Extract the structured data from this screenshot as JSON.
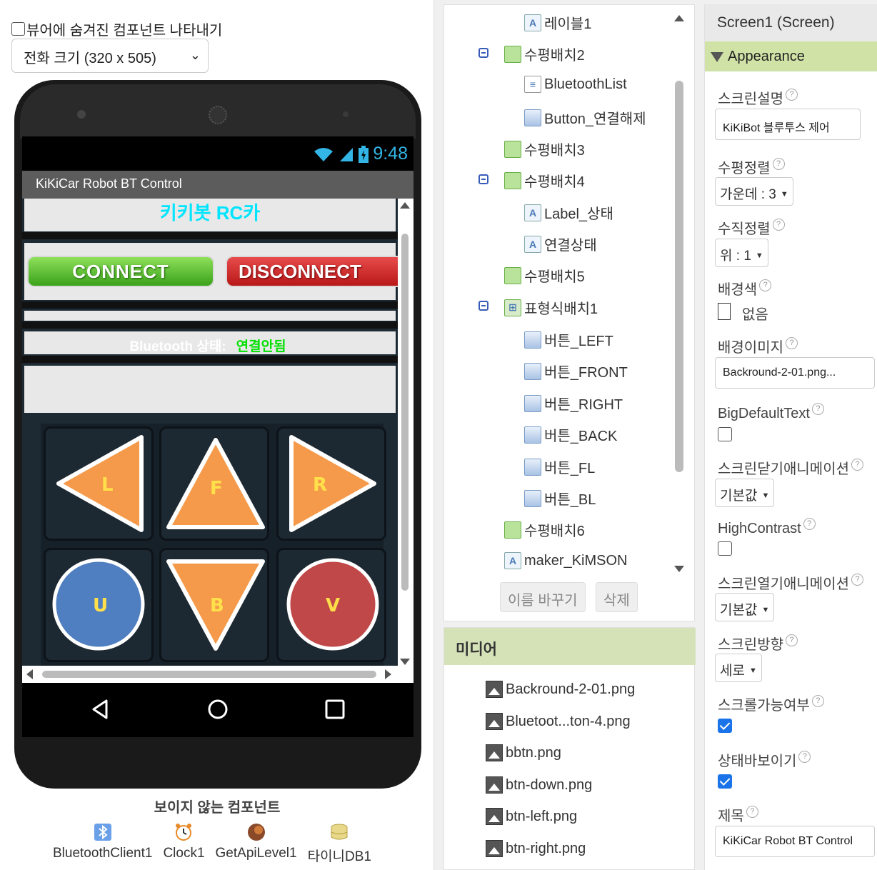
{
  "viewer": {
    "show_hidden_label": "뷰어에 숨겨진 컴포넌트 나타내기",
    "size_select": "전화 크기 (320 x 505)"
  },
  "phone": {
    "status_time": "9:48",
    "title_bar": "KiKiCar Robot BT Control",
    "app_title": "키키봇 RC카",
    "connect_label": "CONNECT",
    "disconnect_label": "DISCONNECT",
    "bt_status_label": "Bluetooth 상태:",
    "bt_status_value": "연결안됨",
    "controls": [
      "L",
      "F",
      "R",
      "U",
      "B",
      "V"
    ]
  },
  "nonvisible": {
    "title": "보이지 않는 컴포넌트",
    "items": [
      "BluetoothClient1",
      "Clock1",
      "GetApiLevel1",
      "타이니DB1"
    ]
  },
  "tree": {
    "items": [
      {
        "label": "레이블1",
        "icon": "label-icon"
      },
      {
        "label": "수평배치2",
        "icon": "horizontal-arrangement-icon"
      },
      {
        "label": "BluetoothList",
        "icon": "list-picker-icon"
      },
      {
        "label": "Button_연결해제",
        "icon": "button-icon"
      },
      {
        "label": "수평배치3",
        "icon": "horizontal-arrangement-icon"
      },
      {
        "label": "수평배치4",
        "icon": "horizontal-arrangement-icon"
      },
      {
        "label": "Label_상태",
        "icon": "label-icon"
      },
      {
        "label": "연결상태",
        "icon": "label-icon"
      },
      {
        "label": "수평배치5",
        "icon": "horizontal-arrangement-icon"
      },
      {
        "label": "표형식배치1",
        "icon": "table-arrangement-icon"
      },
      {
        "label": "버튼_LEFT",
        "icon": "button-icon"
      },
      {
        "label": "버튼_FRONT",
        "icon": "button-icon"
      },
      {
        "label": "버튼_RIGHT",
        "icon": "button-icon"
      },
      {
        "label": "버튼_BACK",
        "icon": "button-icon"
      },
      {
        "label": "버튼_FL",
        "icon": "button-icon"
      },
      {
        "label": "버튼_BL",
        "icon": "button-icon"
      },
      {
        "label": "수평배치6",
        "icon": "horizontal-arrangement-icon"
      },
      {
        "label": "maker_KiMSON",
        "icon": "label-icon"
      }
    ],
    "rename_label": "이름 바꾸기",
    "delete_label": "삭제"
  },
  "media": {
    "title": "미디어",
    "files": [
      "Backround-2-01.png",
      "Bluetoot...ton-4.png",
      "bbtn.png",
      "btn-down.png",
      "btn-left.png",
      "btn-right.png"
    ]
  },
  "properties": {
    "header": "Screen1 (Screen)",
    "section": "Appearance",
    "about_label": "스크린설명",
    "about_value": "KiKiBot 블루투스 제어",
    "align_h_label": "수평정렬",
    "align_h_value": "가운데 : 3",
    "align_v_label": "수직정렬",
    "align_v_value": "위 : 1",
    "bgcolor_label": "배경색",
    "bgcolor_value": "없음",
    "bgimage_label": "배경이미지",
    "bgimage_value": "Backround-2-01.png...",
    "bigtext_label": "BigDefaultText",
    "close_anim_label": "스크린닫기애니메이션",
    "close_anim_value": "기본값",
    "highcontrast_label": "HighContrast",
    "open_anim_label": "스크린열기애니메이션",
    "open_anim_value": "기본값",
    "orientation_label": "스크린방향",
    "orientation_value": "세로",
    "scrollable_label": "스크롤가능여부",
    "statusbar_label": "상태바보이기",
    "title_label": "제목",
    "title_value": "KiKiCar Robot BT Control"
  },
  "colors": {
    "accent_green": "#d0e2a6",
    "connect_green": "#3aa21a",
    "disconnect_red": "#c81e1e",
    "title_cyan": "#00e5ff",
    "status_green": "#00e000",
    "arrow_orange": "#f59a4a",
    "circle_blue": "#4f7fc0",
    "circle_red": "#c04848"
  }
}
